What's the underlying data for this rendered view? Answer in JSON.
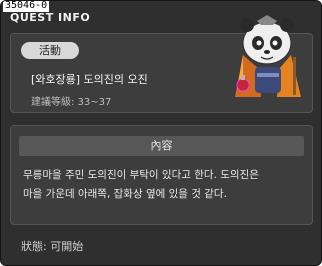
{
  "window": {
    "id_label": "35046-0",
    "title": "QUEST INFO"
  },
  "quest": {
    "status_pill": "活動",
    "name": "[와호장룡] 도의진의 오진",
    "level": "建議等級: 33~37",
    "npc_icon": "panda-npc-icon"
  },
  "description": {
    "header": "內容",
    "line1": "무릉마을 주민 도의진이 부탁이 있다고 한다. 도의진은",
    "line2": "마을 가운데 아래쪽, 잡화상 옆에 있을 것 같다."
  },
  "footer": {
    "status": "狀態:  可開始"
  }
}
